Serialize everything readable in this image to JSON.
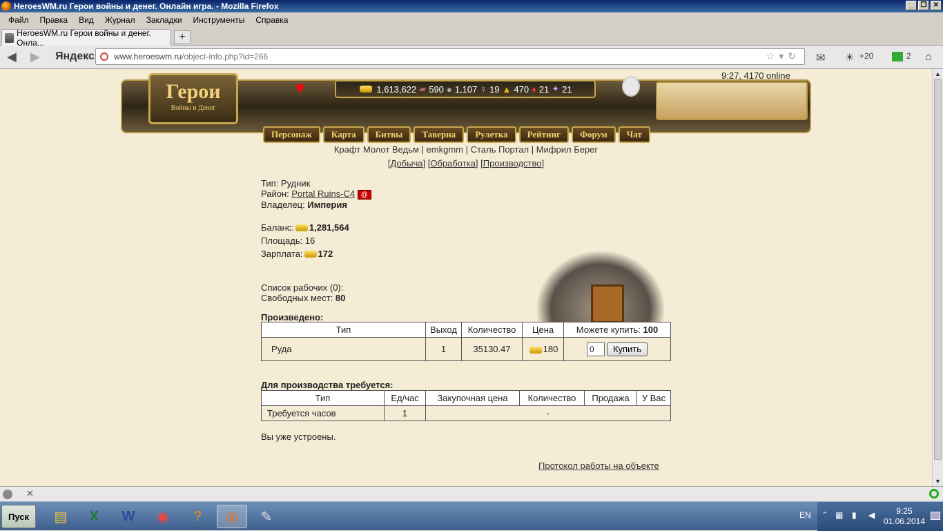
{
  "window": {
    "title": "HeroesWM.ru Герои войны и денег. Онлайн игра. - Mozilla Firefox"
  },
  "menu": [
    "Файл",
    "Правка",
    "Вид",
    "Журнал",
    "Закладки",
    "Инструменты",
    "Справка"
  ],
  "tab": {
    "title": "HeroesWM.ru Герои войны и денег. Онла..."
  },
  "toolbar": {
    "search_brand": "Яндекс",
    "url_host": "www.heroeswm.ru",
    "url_tail": "/object-info.php?id=266",
    "weather": "+20",
    "counter": "2"
  },
  "game": {
    "logo_title": "Герои",
    "logo_subtitle": "Войны и Денег",
    "online": "9:27, 4170 online",
    "resources": {
      "gold": "1,613,622",
      "wood": "590",
      "ore": "1,107",
      "mercury": "19",
      "sulfur": "470",
      "crystals": "21",
      "gems": "21"
    },
    "nav": [
      "Персонаж",
      "Карта",
      "Битвы",
      "Таверна",
      "Рулетка",
      "Рейтинг",
      "Форум",
      "Чат"
    ],
    "clan_links": "Крафт Молот Ведьм | emkgmm | Сталь Портал | Мифрил Берег",
    "sub_links": [
      "Добыча",
      "Обработка",
      "Производство"
    ]
  },
  "object": {
    "type_label": "Тип:",
    "type_value": "Рудник",
    "district_label": "Район:",
    "district_value": "Portal Ruins-C4",
    "district_badge": "@",
    "owner_label": "Владелец:",
    "owner_value": "Империя",
    "balance_label": "Баланс:",
    "balance_value": "1,281,564",
    "area_label": "Площадь:",
    "area_value": "16",
    "salary_label": "Зарплата:",
    "salary_value": "172",
    "workers_label": "Список рабочих (0):",
    "free_label": "Свободных мест:",
    "free_value": "80"
  },
  "produced": {
    "heading": "Произведено:",
    "headers": [
      "Тип",
      "Выход",
      "Количество",
      "Цена",
      "Можете купить:"
    ],
    "can_buy": "100",
    "row": {
      "type": "Руда",
      "output": "1",
      "quantity": "35130.47",
      "price": "180",
      "input_value": "0",
      "buy_label": "Купить"
    }
  },
  "required": {
    "heading": "Для производства требуется:",
    "headers": [
      "Тип",
      "Ед/час",
      "Закупочная цена",
      "Количество",
      "Продажа",
      "У Вас"
    ],
    "row": {
      "type": "Требуется часов",
      "per_hour": "1",
      "rest": "-"
    }
  },
  "status": "Вы уже устроены.",
  "protocol_link": "Протокол работы на объекте",
  "taskbar": {
    "start": "Пуск",
    "lang": "EN",
    "time": "9:25",
    "date": "01.06.2014"
  },
  "colors": {
    "page_bg": "#f5ecd6",
    "nav_text": "#f6d374",
    "gold": "#e8b800",
    "border": "#c9a74e"
  }
}
